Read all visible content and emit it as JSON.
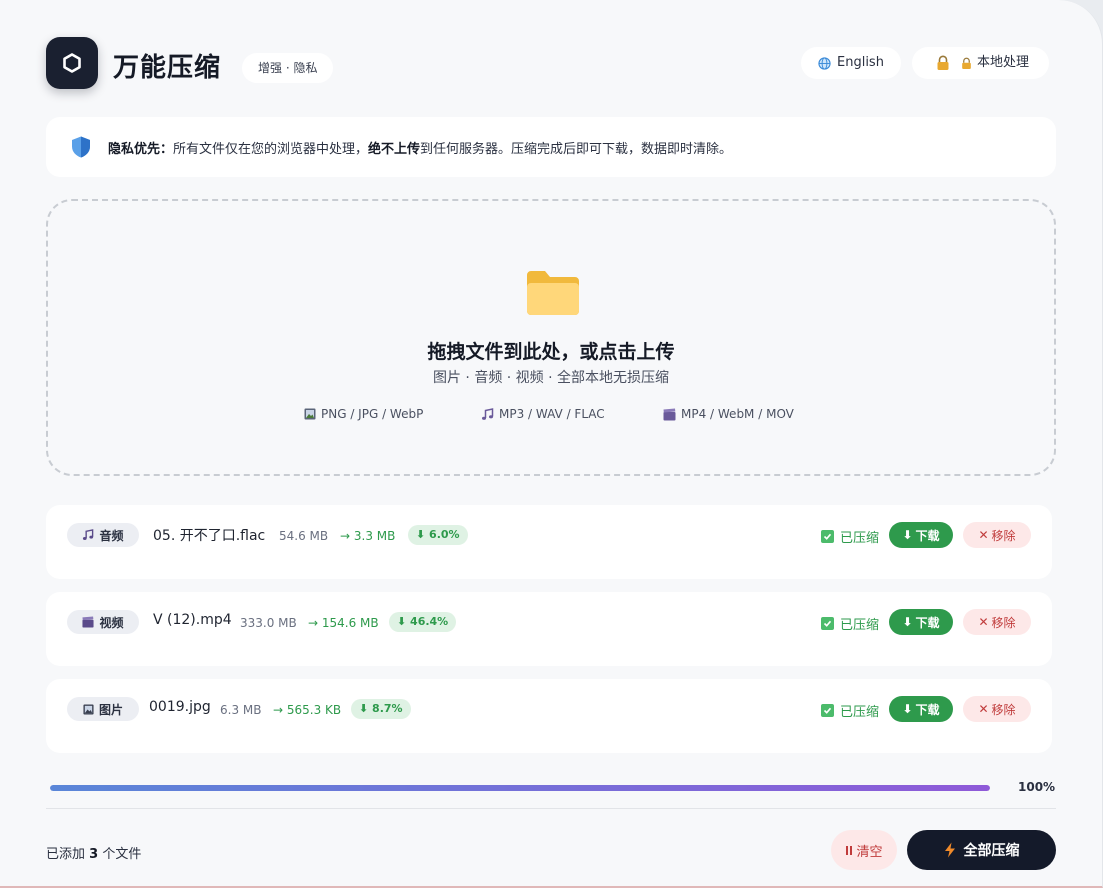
{
  "header": {
    "title": "万能压缩",
    "tag": "增强 · 隐私",
    "language_button": "English",
    "local_button": "本地处理"
  },
  "privacy": {
    "label": "隐私优先：",
    "text_before": "所有文件仅在您的浏览器中处理，",
    "emphasis": "绝不上传",
    "text_after": "到任何服务器。压缩完成后即可下载，数据即时清除。"
  },
  "dropzone": {
    "title": "拖拽文件到此处，或点击上传",
    "subtitle": "图片 · 音频 · 视频 · 全部本地无损压缩",
    "formats": {
      "image": "PNG / JPG / WebP",
      "audio": "MP3 / WAV / FLAC",
      "video": "MP4 / WebM / MOV"
    }
  },
  "files": [
    {
      "type_label": "音频",
      "type_icon": "music-note-icon",
      "name": "05. 开不了口.flac",
      "original_size": "54.6 MB",
      "compressed_size": "→ 3.3 MB",
      "ratio": "⬇ 6.0%",
      "status": "已压缩",
      "download_label": "下载",
      "remove_label": "移除"
    },
    {
      "type_label": "视频",
      "type_icon": "clapperboard-icon",
      "name": "V (12).mp4",
      "original_size": "333.0 MB",
      "compressed_size": "→ 154.6 MB",
      "ratio": "⬇ 46.4%",
      "status": "已压缩",
      "download_label": "下载",
      "remove_label": "移除"
    },
    {
      "type_label": "图片",
      "type_icon": "picture-icon",
      "name": "0019.jpg",
      "original_size": "6.3 MB",
      "compressed_size": "→ 565.3 KB",
      "ratio": "⬇ 8.7%",
      "status": "已压缩",
      "download_label": "下载",
      "remove_label": "移除"
    }
  ],
  "progress": {
    "value": 100,
    "label": "100%"
  },
  "footer": {
    "count_prefix": "已添加",
    "count": "3",
    "count_suffix": "个文件",
    "clear_label": "清空",
    "compress_all_label": "全部压缩"
  },
  "colors": {
    "accent_dark": "#141a2a",
    "success": "#2e9a4c",
    "danger": "#c03b3b",
    "progress_start": "#5a86d8",
    "progress_end": "#8f5ad8"
  }
}
